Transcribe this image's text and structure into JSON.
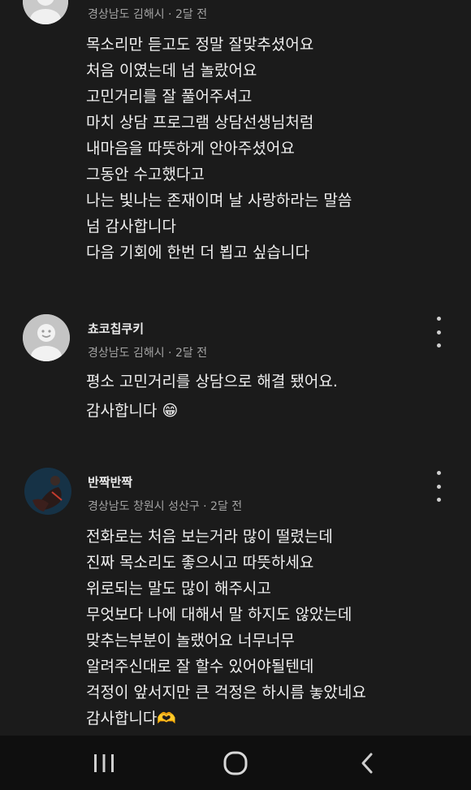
{
  "comments": [
    {
      "meta": "경상남도 김해시 · 2달 전",
      "lines": [
        "목소리만 듣고도 정말 잘맞추셨어요",
        "처음 이였는데 넘 놀랐어요",
        "고민거리를 잘 풀어주셔고",
        "마치 상담 프로그램 상담선생님처럼",
        "내마음을 따뜻하게 안아주셨어요",
        "그동안 수고했다고",
        "나는 빛나는 존재이며 날 사랑하라는 말씀",
        "넘 감사합니다",
        "다음 기회에 한번 더 뵙고 싶습니다"
      ]
    },
    {
      "author": "쵸코칩쿠키",
      "meta": "경상남도 김해시 · 2달 전",
      "lines": [
        "평소 고민거리를 상담으로 해결 됐어요.",
        "감사합니다 😁"
      ]
    },
    {
      "author": "반짝반짝",
      "meta": "경상남도 창원시 성산구 · 2달 전",
      "lines": [
        "전화로는  처음 보는거라 많이  떨렸는데",
        "진짜 목소리도 좋으시고 따뜻하세요",
        "위로되는 말도  많이 해주시고",
        "무엇보다 나에 대해서 말 하지도 않았는데",
        "맞추는부분이  놀랬어요  너무너무",
        "알려주신대로  잘 할수 있어야될텐데",
        "걱정이 앞서지만  큰  걱정은 하시름  놓았네요",
        "감사합니다🫶"
      ]
    }
  ],
  "navbar": {
    "icons": [
      "recent-apps-icon",
      "home-icon",
      "back-icon"
    ]
  }
}
